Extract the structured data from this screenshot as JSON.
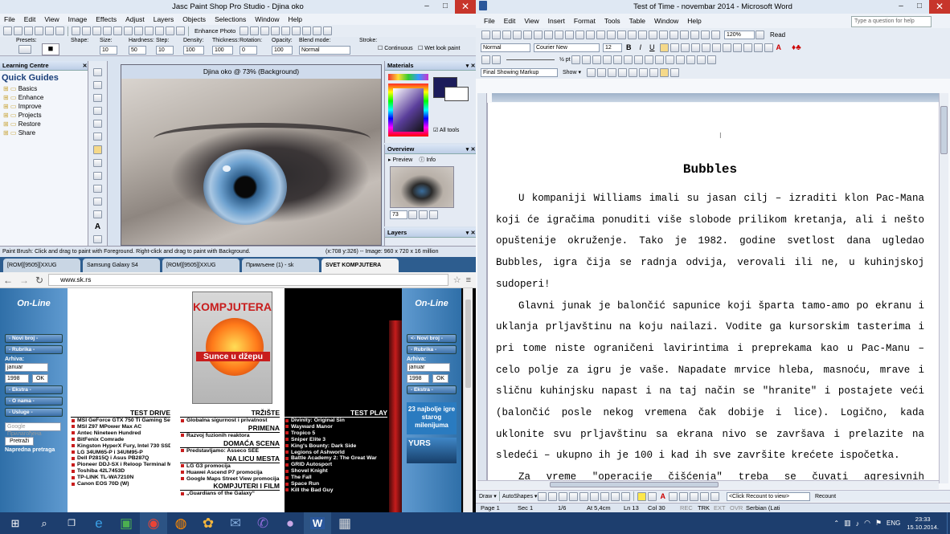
{
  "psp": {
    "title": "Jasc Paint Shop Pro Studio - Djina oko",
    "menu": [
      "File",
      "Edit",
      "View",
      "Image",
      "Effects",
      "Adjust",
      "Layers",
      "Objects",
      "Selections",
      "Window",
      "Help"
    ],
    "enhance_photo": "Enhance Photo",
    "tool_options": {
      "labels": [
        "Presets:",
        "Shape:",
        "Size:",
        "Hardness:",
        "Step:",
        "Density:",
        "Thickness:",
        "Rotation:",
        "Opacity:",
        "Blend mode:",
        "Stroke:"
      ],
      "size": "10",
      "hardness": "50",
      "step": "10",
      "density": "100",
      "thickness": "100",
      "rotation": "0",
      "opacity": "100",
      "blend_mode": "Normal",
      "continuous": "Continuous",
      "wet_look": "Wet look paint"
    },
    "learning_centre": "Learning Centre",
    "quick_guides": "Quick Guides",
    "guides": [
      "Basics",
      "Enhance",
      "Improve",
      "Projects",
      "Restore",
      "Share"
    ],
    "image_title": "Djina oko @ 73% (Background)",
    "materials": "Materials",
    "all_tools": "All tools",
    "overview": "Overview",
    "preview_tab": "Preview",
    "info_tab": "Info",
    "zoom": "73",
    "layers": "Layers",
    "status_left": "Paint Brush: Click and drag to paint with Foreground. Right-click and drag to paint with Background.",
    "status_right": "(x:708 y:326) -- Image: 960 x 720 x 16 million"
  },
  "browser": {
    "tabs": [
      "[ROM][9505][XXUG",
      "Samsung Galaxy S4",
      "[ROM][9505][XXUG",
      "Примљене (1) - sk",
      "SVET KOMPJUTERA"
    ],
    "url": "www.sk.rs",
    "logo_left": "On-Line",
    "logo_right": "On-Line",
    "nav": [
      "- Novi broj -",
      "- Rubrika -",
      "- Ekstra -",
      "- O nama -",
      "- Usluge -"
    ],
    "nav_right": [
      "<- Novi broj -",
      "- Rubrika -",
      "- Ekstra -"
    ],
    "arhiva": "Arhiva:",
    "month": "januar",
    "year": "1998",
    "ok": "OK",
    "search_placeholder": "Google Прилагођена",
    "search_btn": "Pretraži",
    "napredna": "Napredna pretraga",
    "magazine_title": "KOMPJUTERA",
    "magazine_cover": "Sunce u džepu",
    "test_drive_title": "TEST DRIVE",
    "test_drive": [
      "MSI GeForce GTX 750 Ti Gaming Series OC Edition",
      "MSI Z97 MPower Max AC",
      "Antec Nineteen Hundred",
      "BitFenix Comrade",
      "Kingston HyperX Fury, Intel 730 SSD",
      "LG 34UM65-P i 34UM95-P",
      "Dell P2815Q i Asus PB287Q",
      "Pioneer DDJ-SX i Reloop Terminal Mix 8",
      "Toshiba 42L7453D",
      "TP-LINK TL-WA7210N",
      "Canon EOS 70D (W)"
    ],
    "trziste_title": "TRŽIŠTE",
    "trziste": [
      "Globalna sigurnost i privatnost"
    ],
    "primena_title": "PRIMENA",
    "primena": [
      "Razvoj fuzionih reaktora"
    ],
    "domaca_title": "DOMAĆA SCENA",
    "domaca": [
      "Predstavljamo: Asseco SEE"
    ],
    "licu_title": "NA LICU MESTA",
    "licu": [
      "LG G3 promocija",
      "Huawei Ascend P7 promocija",
      "Google Maps Street View promocija"
    ],
    "kompjuteri_title": "KOMPJUTERI I FILM",
    "kompjuteri": [
      "„Guardians of the Galaxy“"
    ],
    "test_play_title": "TEST PLAY",
    "test_play": [
      "Divinity: Original Sin",
      "Wayward Manor",
      "Tropico 5",
      "Sniper Elite 3",
      "King's Bounty: Dark Side",
      "Legions of Ashworld",
      "Battle Academy 2: The Great War",
      "GRID Autosport",
      "Shovel Knight",
      "The Fall",
      "Space Run",
      "Kill the Bad Guy"
    ],
    "promo": "23 najbolje igre starog milenijuma",
    "yurs": "YURS"
  },
  "word": {
    "title": "Test of Time - novembar 2014 - Microsoft Word",
    "menu": [
      "File",
      "Edit",
      "View",
      "Insert",
      "Format",
      "Tools",
      "Table",
      "Window",
      "Help"
    ],
    "help_box": "Type a question for help",
    "zoom": "120%",
    "read": "Read",
    "style": "Normal",
    "font": "Courier New",
    "size": "12",
    "markup": "Final Showing Markup",
    "show": "Show",
    "heading": "Bubbles",
    "paragraphs": [
      "U kompaniji Williams imali su jasan cilj – izraditi klon Pac-Mana koji će igračima ponuditi više slobode prilikom kretanja, ali i nešto opuštenije okruženje. Tako je 1982. godine svetlost dana ugledao Bubbles, igra čija se radnja odvija, verovali ili ne, u kuhinjskoj sudoperi!",
      "Glavni junak je balončić sapunice koji šparta tamo-amo po ekranu i uklanja prljavštinu na koju nailazi. Vodite ga kursorskim tasterima i pri tome niste ograničeni lavirintima i preprekama kao u Pac-Manu – celo polje za igru je vaše. Napadate mrvice hleba, masnoću, mrave i sličnu kuhinjsku napast i na taj način se \"hranite\" i postajete veći (balončić posle nekog vremena čak dobije i lice). Logično, kada uklonite svu prljavštinu sa ekrana nivo se završava i prelazite na sledeći – ukupno ih je 100 i kad ih sve završite krećete ispočetka.",
      "Za vreme \"operacije čišćenja\" treba se čuvati agresivnih neprijatelja"
    ],
    "draw": "Draw",
    "autoshapes": "AutoShapes",
    "recount": "<Click Recount to view>",
    "recount_btn": "Recount",
    "status": {
      "page": "Page 1",
      "sec": "Sec 1",
      "pages": "1/6",
      "at": "At 5,4cm",
      "ln": "Ln 13",
      "col": "Col 30",
      "rec": "REC",
      "trk": "TRK",
      "ext": "EXT",
      "ovr": "OVR",
      "lang": "Serbian (Lati"
    }
  },
  "taskbar": {
    "language": "ENG",
    "time": "23:33",
    "date": "15.10.2014."
  }
}
